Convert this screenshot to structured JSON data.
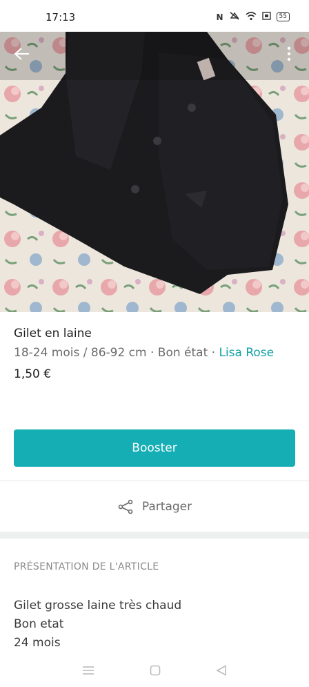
{
  "status_bar": {
    "time": "17:13",
    "battery": "55",
    "icons": [
      "nfc-icon",
      "mute-icon",
      "wifi-icon",
      "sim-icon",
      "battery-icon"
    ]
  },
  "item": {
    "title": "Gilet en laine",
    "size_condition": "18-24 mois / 86-92 cm · Bon état · ",
    "brand": "Lisa Rose",
    "price": "1,50 €"
  },
  "actions": {
    "booster_label": "Booster",
    "share_label": "Partager"
  },
  "section": {
    "title": "PRÉSENTATION DE L'ARTICLE"
  },
  "description": {
    "lines": [
      "Gilet grosse laine très chaud",
      "Bon etat",
      "24 mois"
    ]
  },
  "colors": {
    "accent": "#14aeb4",
    "brand_link": "#13a1a8",
    "text_secondary": "#6b6b6b"
  }
}
